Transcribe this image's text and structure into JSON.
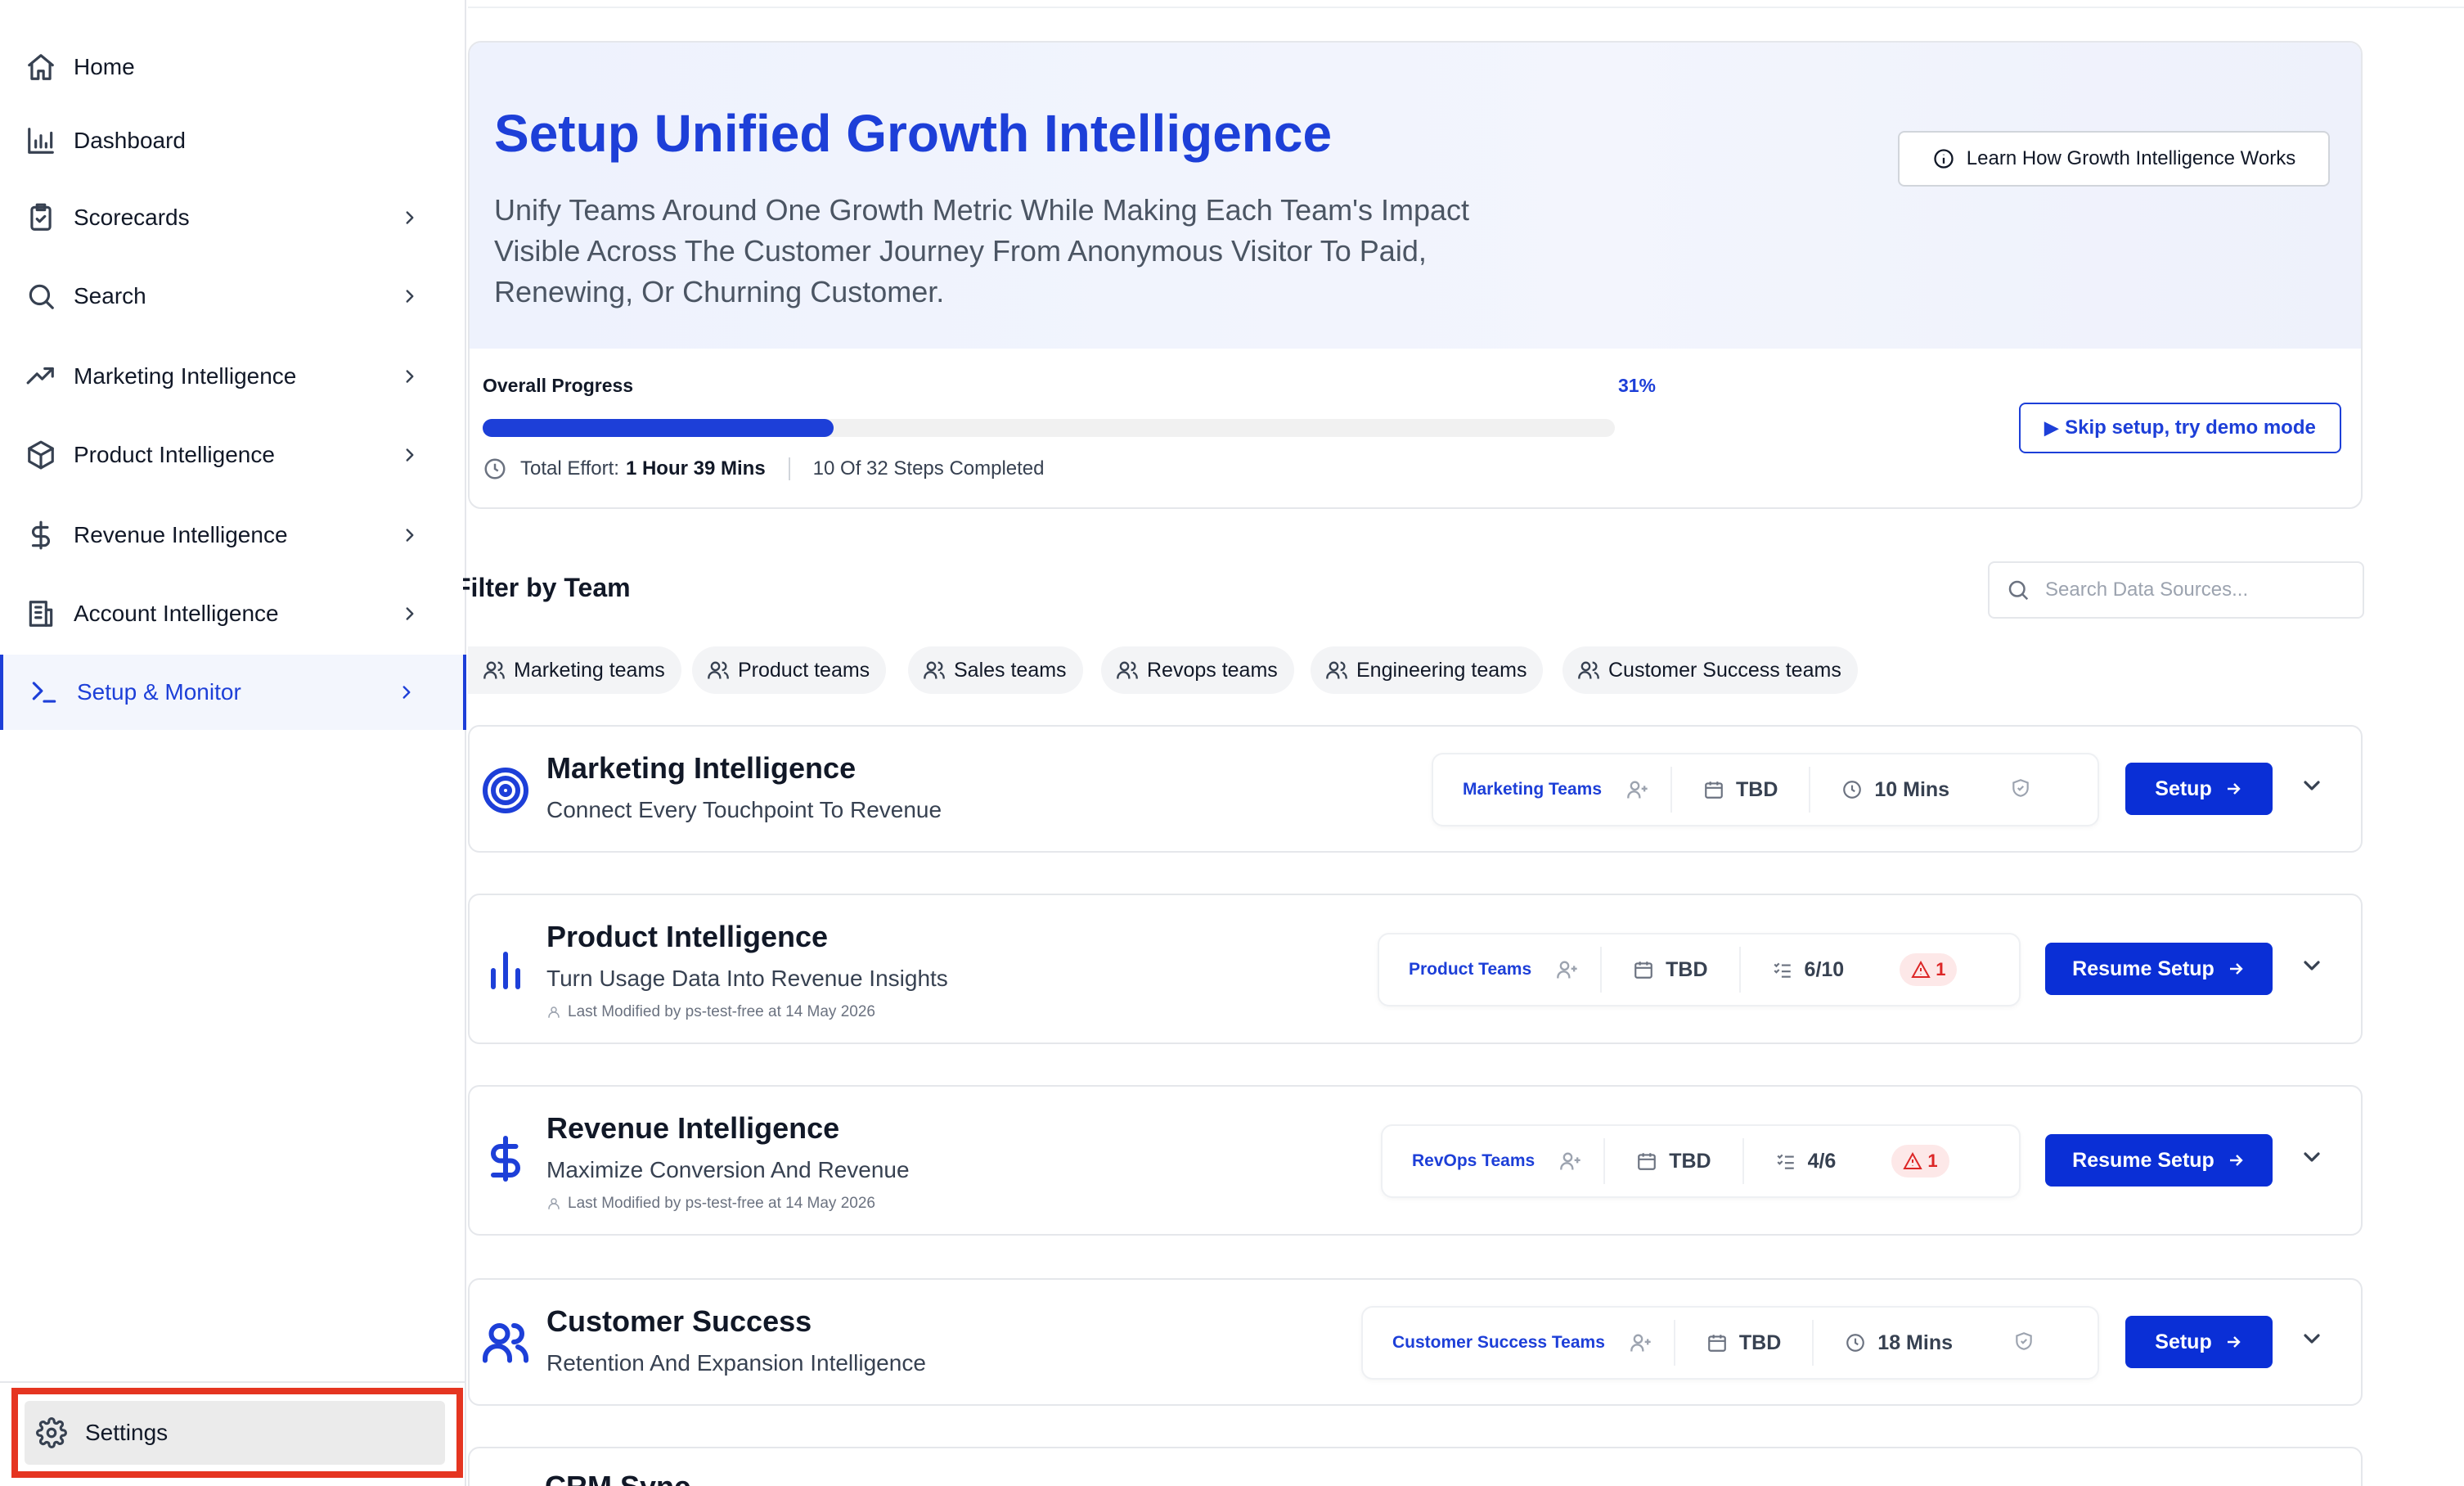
{
  "sidebar": {
    "items": [
      {
        "label": "Home",
        "icon": "home-icon"
      },
      {
        "label": "Dashboard",
        "icon": "bar-chart-icon"
      },
      {
        "label": "Scorecards",
        "icon": "clipboard-check-icon"
      },
      {
        "label": "Search",
        "icon": "search-icon"
      },
      {
        "label": "Marketing Intelligence",
        "icon": "trending-up-icon"
      },
      {
        "label": "Product Intelligence",
        "icon": "package-icon"
      },
      {
        "label": "Revenue Intelligence",
        "icon": "dollar-icon"
      },
      {
        "label": "Account Intelligence",
        "icon": "building-icon"
      },
      {
        "label": "Setup & Monitor",
        "icon": "terminal-icon",
        "active": true
      }
    ],
    "settings_label": "Settings",
    "highlight_color": "#e53521"
  },
  "hero": {
    "title": "Setup Unified Growth Intelligence",
    "subtitle": "Unify Teams Around One Growth Metric While Making Each Team's Impact Visible Across The Customer Journey From Anonymous Visitor To Paid, Renewing, Or Churning Customer.",
    "learn_button": "Learn How Growth Intelligence Works",
    "progress_label": "Overall Progress",
    "progress_pct": "31%",
    "progress_value": 0.31,
    "effort_label": "Total Effort:",
    "effort_value": "1 Hour 39 Mins",
    "steps_text": "10 Of 32 Steps Completed",
    "demo_button": "Skip setup, try demo mode"
  },
  "filter": {
    "title": "Filter by Team",
    "search_placeholder": "Search Data Sources...",
    "chips": [
      "Marketing teams",
      "Product teams",
      "Sales teams",
      "Revops teams",
      "Engineering teams",
      "Customer Success teams"
    ]
  },
  "cards": [
    {
      "title": "Marketing Intelligence",
      "subtitle": "Connect Every Touchpoint To Revenue",
      "team": "Marketing Teams",
      "date": "TBD",
      "time": "10 Mins",
      "button": "Setup"
    },
    {
      "title": "Product Intelligence",
      "subtitle": "Turn Usage Data Into Revenue Insights",
      "modified": "Last Modified by ps-test-free at 14 May 2026",
      "team": "Product Teams",
      "date": "TBD",
      "steps": "6/10",
      "warnings": "1",
      "button": "Resume Setup"
    },
    {
      "title": "Revenue Intelligence",
      "subtitle": "Maximize Conversion And Revenue",
      "modified": "Last Modified by ps-test-free at 14 May 2026",
      "team": "RevOps Teams",
      "date": "TBD",
      "steps": "4/6",
      "warnings": "1",
      "button": "Resume Setup"
    },
    {
      "title": "Customer Success",
      "subtitle": "Retention And Expansion Intelligence",
      "team": "Customer Success Teams",
      "date": "TBD",
      "time": "18 Mins",
      "button": "Setup"
    }
  ],
  "partial_card_title": "CRM Sync",
  "colors": {
    "accent": "#1d3fd8",
    "button": "#0a2fd6",
    "warning": "#dc2626"
  }
}
